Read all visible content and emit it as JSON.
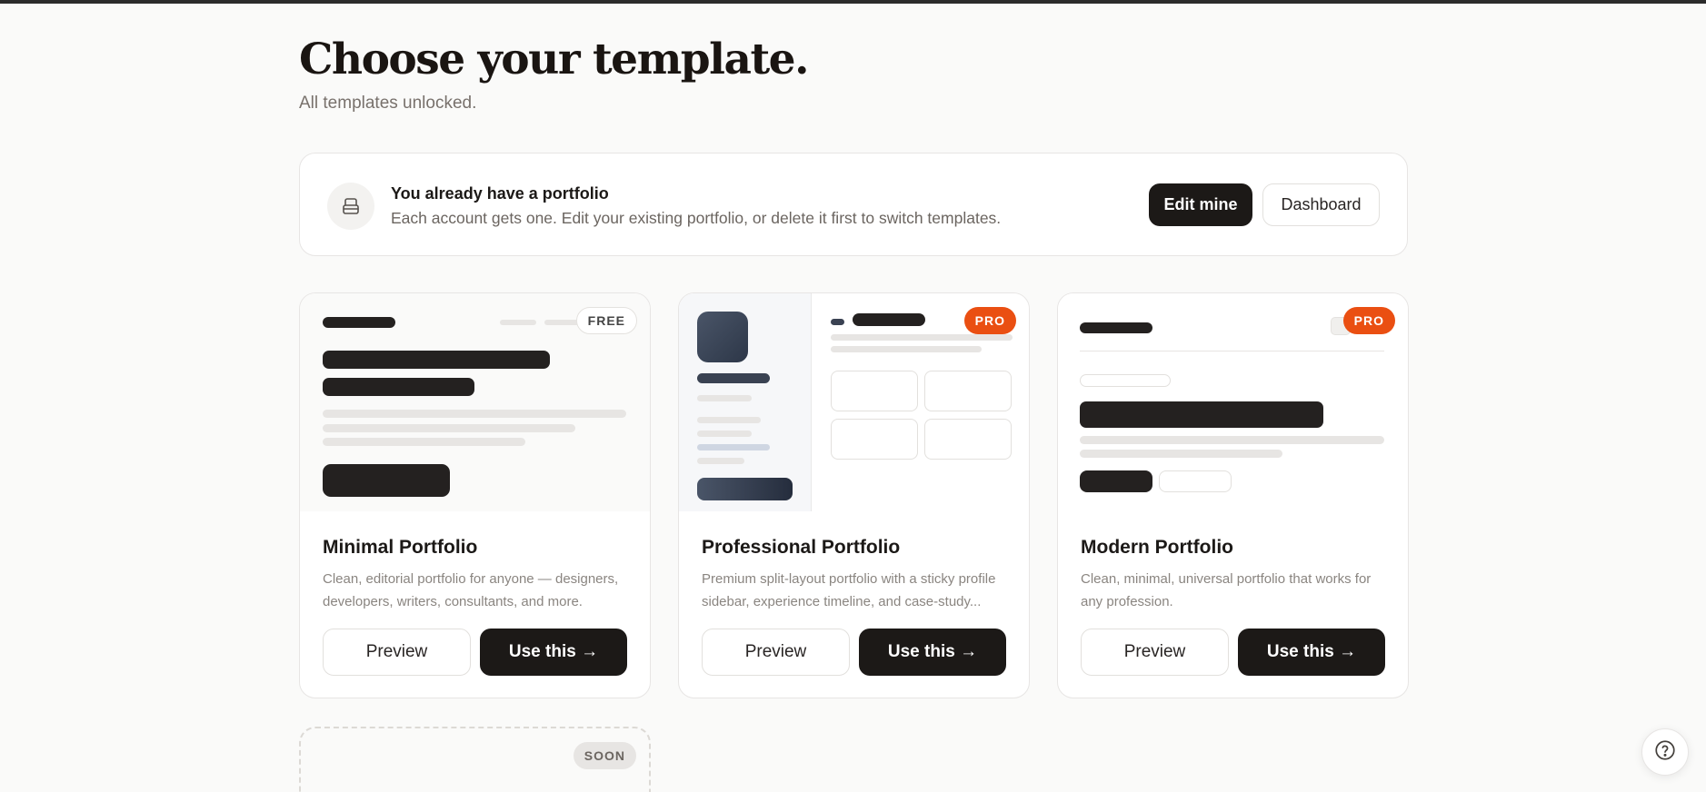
{
  "page": {
    "title": "Choose your template.",
    "subtitle": "All templates unlocked."
  },
  "notice": {
    "icon": "inbox-icon",
    "title": "You already have a portfolio",
    "text": "Each account gets one. Edit your existing portfolio, or delete it first to switch templates.",
    "edit_label": "Edit mine",
    "dashboard_label": "Dashboard"
  },
  "templates": [
    {
      "name": "Minimal Portfolio",
      "badge": "FREE",
      "description": "Clean, editorial portfolio for anyone — designers, developers, writers, consultants, and more.",
      "preview_label": "Preview",
      "use_label": "Use this →"
    },
    {
      "name": "Professional Portfolio",
      "badge": "PRO",
      "description": "Premium split-layout portfolio with a sticky profile sidebar, experience timeline, and case-study...",
      "preview_label": "Preview",
      "use_label": "Use this →"
    },
    {
      "name": "Modern Portfolio",
      "badge": "PRO",
      "description": "Clean, minimal, universal portfolio that works for any profession.",
      "preview_label": "Preview",
      "use_label": "Use this →"
    }
  ],
  "coming_soon": {
    "badge": "SOON"
  },
  "help": {
    "icon": "help-circle-icon"
  },
  "colors": {
    "accent_pro": "#ea4f12",
    "primary_dark": "#1c1917",
    "background": "#fafaf9"
  }
}
